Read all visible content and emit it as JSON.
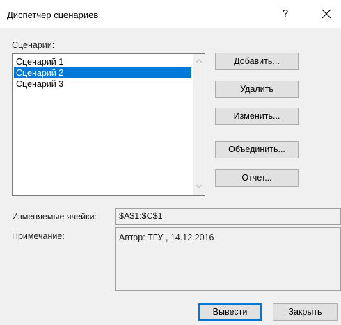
{
  "window": {
    "title": "Диспетчер сценариев",
    "help_symbol": "?",
    "close_symbol": "✕"
  },
  "scenarios": {
    "label": "Сценарии:",
    "items": [
      {
        "label": "Сценарий 1",
        "selected": false
      },
      {
        "label": "Сценарий 2",
        "selected": true
      },
      {
        "label": "Сценарий 3",
        "selected": false
      }
    ]
  },
  "buttons": {
    "add": "Добавить...",
    "delete": "Удалить",
    "edit": "Изменить...",
    "merge": "Объединить...",
    "report": "Отчет...",
    "show": "Вывести",
    "close": "Закрыть"
  },
  "changing_cells": {
    "label": "Изменяемые ячейки:",
    "value": "$A$1:$C$1"
  },
  "comment": {
    "label": "Примечание:",
    "value": "Автор: ТГУ , 14.12.2016"
  },
  "colors": {
    "selection": "#0078d7",
    "dialog_bg": "#f0f0f0",
    "button_bg": "#e1e1e1"
  }
}
